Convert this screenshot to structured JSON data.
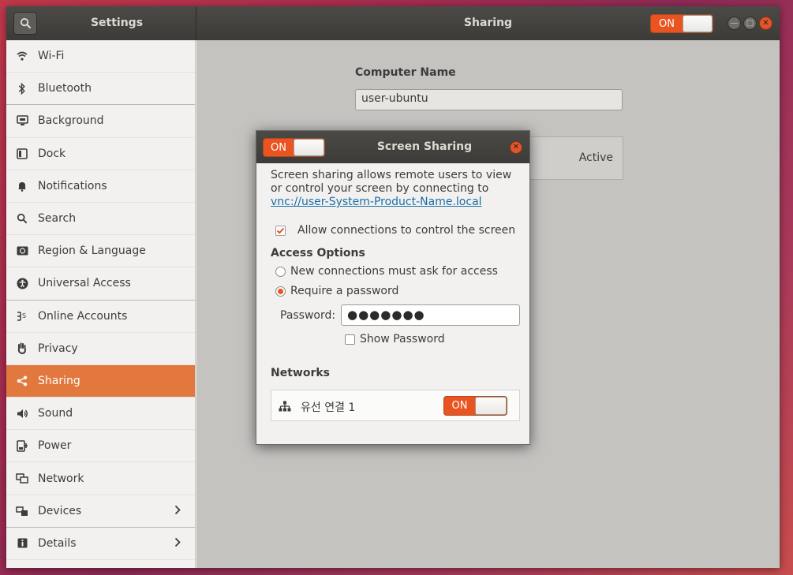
{
  "titlebar": {
    "app_title": "Settings",
    "panel_title": "Sharing",
    "switch_label": "ON"
  },
  "sidebar": {
    "items": [
      {
        "label": "Wi-Fi",
        "icon": "wifi-icon"
      },
      {
        "label": "Bluetooth",
        "icon": "bluetooth-icon"
      },
      {
        "label": "Background",
        "icon": "background-icon"
      },
      {
        "label": "Dock",
        "icon": "dock-icon"
      },
      {
        "label": "Notifications",
        "icon": "bell-icon"
      },
      {
        "label": "Search",
        "icon": "search-icon"
      },
      {
        "label": "Region & Language",
        "icon": "region-icon"
      },
      {
        "label": "Universal Access",
        "icon": "accessibility-icon"
      },
      {
        "label": "Online Accounts",
        "icon": "online-accounts-icon"
      },
      {
        "label": "Privacy",
        "icon": "hand-icon"
      },
      {
        "label": "Sharing",
        "icon": "share-icon",
        "active": true
      },
      {
        "label": "Sound",
        "icon": "speaker-icon"
      },
      {
        "label": "Power",
        "icon": "power-icon"
      },
      {
        "label": "Network",
        "icon": "network-icon"
      },
      {
        "label": "Devices",
        "icon": "devices-icon",
        "chevron": true
      },
      {
        "label": "Details",
        "icon": "info-icon",
        "chevron": true
      }
    ]
  },
  "main": {
    "computer_name_label": "Computer Name",
    "computer_name_value": "user-ubuntu",
    "row_status": "Active"
  },
  "dialog": {
    "switch_label": "ON",
    "title": "Screen Sharing",
    "description_text": "Screen sharing allows remote users to view or control your screen by connecting to ",
    "description_link": "vnc://user-System-Product-Name.local",
    "allow_control_label": "Allow connections to control the screen",
    "access_options_title": "Access Options",
    "option_ask": "New connections must ask for access",
    "option_password": "Require a password",
    "password_label": "Password:",
    "password_value": "●●●●●●●",
    "show_password_label": "Show Password",
    "networks_title": "Networks",
    "network_name": "유선 연결 1",
    "network_switch_label": "ON"
  },
  "colors": {
    "accent": "#e95420",
    "sidebar_active": "#e2783e",
    "titlebar": "#3c3b37"
  }
}
